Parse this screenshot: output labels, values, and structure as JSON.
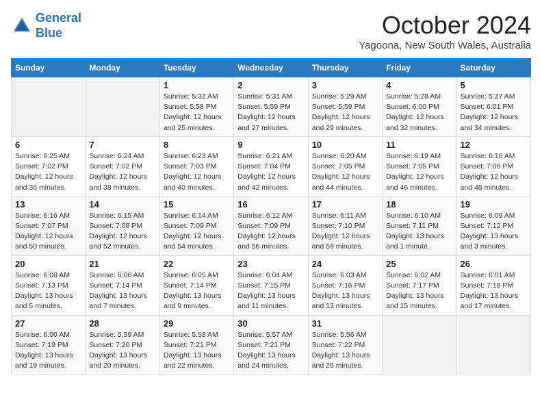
{
  "header": {
    "logo_line1": "General",
    "logo_line2": "Blue",
    "month": "October 2024",
    "location": "Yagoona, New South Wales, Australia"
  },
  "days_of_week": [
    "Sunday",
    "Monday",
    "Tuesday",
    "Wednesday",
    "Thursday",
    "Friday",
    "Saturday"
  ],
  "weeks": [
    [
      {
        "day": "",
        "info": ""
      },
      {
        "day": "",
        "info": ""
      },
      {
        "day": "1",
        "info": "Sunrise: 5:32 AM\nSunset: 5:58 PM\nDaylight: 12 hours\nand 25 minutes."
      },
      {
        "day": "2",
        "info": "Sunrise: 5:31 AM\nSunset: 5:59 PM\nDaylight: 12 hours\nand 27 minutes."
      },
      {
        "day": "3",
        "info": "Sunrise: 5:29 AM\nSunset: 5:59 PM\nDaylight: 12 hours\nand 29 minutes."
      },
      {
        "day": "4",
        "info": "Sunrise: 5:28 AM\nSunset: 6:00 PM\nDaylight: 12 hours\nand 32 minutes."
      },
      {
        "day": "5",
        "info": "Sunrise: 5:27 AM\nSunset: 6:01 PM\nDaylight: 12 hours\nand 34 minutes."
      }
    ],
    [
      {
        "day": "6",
        "info": "Sunrise: 6:25 AM\nSunset: 7:02 PM\nDaylight: 12 hours\nand 36 minutes."
      },
      {
        "day": "7",
        "info": "Sunrise: 6:24 AM\nSunset: 7:02 PM\nDaylight: 12 hours\nand 38 minutes."
      },
      {
        "day": "8",
        "info": "Sunrise: 6:23 AM\nSunset: 7:03 PM\nDaylight: 12 hours\nand 40 minutes."
      },
      {
        "day": "9",
        "info": "Sunrise: 6:21 AM\nSunset: 7:04 PM\nDaylight: 12 hours\nand 42 minutes."
      },
      {
        "day": "10",
        "info": "Sunrise: 6:20 AM\nSunset: 7:05 PM\nDaylight: 12 hours\nand 44 minutes."
      },
      {
        "day": "11",
        "info": "Sunrise: 6:19 AM\nSunset: 7:05 PM\nDaylight: 12 hours\nand 46 minutes."
      },
      {
        "day": "12",
        "info": "Sunrise: 6:18 AM\nSunset: 7:06 PM\nDaylight: 12 hours\nand 48 minutes."
      }
    ],
    [
      {
        "day": "13",
        "info": "Sunrise: 6:16 AM\nSunset: 7:07 PM\nDaylight: 12 hours\nand 50 minutes."
      },
      {
        "day": "14",
        "info": "Sunrise: 6:15 AM\nSunset: 7:08 PM\nDaylight: 12 hours\nand 52 minutes."
      },
      {
        "day": "15",
        "info": "Sunrise: 6:14 AM\nSunset: 7:09 PM\nDaylight: 12 hours\nand 54 minutes."
      },
      {
        "day": "16",
        "info": "Sunrise: 6:12 AM\nSunset: 7:09 PM\nDaylight: 12 hours\nand 56 minutes."
      },
      {
        "day": "17",
        "info": "Sunrise: 6:11 AM\nSunset: 7:10 PM\nDaylight: 12 hours\nand 59 minutes."
      },
      {
        "day": "18",
        "info": "Sunrise: 6:10 AM\nSunset: 7:11 PM\nDaylight: 13 hours\nand 1 minute."
      },
      {
        "day": "19",
        "info": "Sunrise: 6:09 AM\nSunset: 7:12 PM\nDaylight: 13 hours\nand 3 minutes."
      }
    ],
    [
      {
        "day": "20",
        "info": "Sunrise: 6:08 AM\nSunset: 7:13 PM\nDaylight: 13 hours\nand 5 minutes."
      },
      {
        "day": "21",
        "info": "Sunrise: 6:06 AM\nSunset: 7:14 PM\nDaylight: 13 hours\nand 7 minutes."
      },
      {
        "day": "22",
        "info": "Sunrise: 6:05 AM\nSunset: 7:14 PM\nDaylight: 13 hours\nand 9 minutes."
      },
      {
        "day": "23",
        "info": "Sunrise: 6:04 AM\nSunset: 7:15 PM\nDaylight: 13 hours\nand 11 minutes."
      },
      {
        "day": "24",
        "info": "Sunrise: 6:03 AM\nSunset: 7:16 PM\nDaylight: 13 hours\nand 13 minutes."
      },
      {
        "day": "25",
        "info": "Sunrise: 6:02 AM\nSunset: 7:17 PM\nDaylight: 13 hours\nand 15 minutes."
      },
      {
        "day": "26",
        "info": "Sunrise: 6:01 AM\nSunset: 7:18 PM\nDaylight: 13 hours\nand 17 minutes."
      }
    ],
    [
      {
        "day": "27",
        "info": "Sunrise: 6:00 AM\nSunset: 7:19 PM\nDaylight: 13 hours\nand 19 minutes."
      },
      {
        "day": "28",
        "info": "Sunrise: 5:59 AM\nSunset: 7:20 PM\nDaylight: 13 hours\nand 20 minutes."
      },
      {
        "day": "29",
        "info": "Sunrise: 5:58 AM\nSunset: 7:21 PM\nDaylight: 13 hours\nand 22 minutes."
      },
      {
        "day": "30",
        "info": "Sunrise: 5:57 AM\nSunset: 7:21 PM\nDaylight: 13 hours\nand 24 minutes."
      },
      {
        "day": "31",
        "info": "Sunrise: 5:56 AM\nSunset: 7:22 PM\nDaylight: 13 hours\nand 26 minutes."
      },
      {
        "day": "",
        "info": ""
      },
      {
        "day": "",
        "info": ""
      }
    ]
  ]
}
